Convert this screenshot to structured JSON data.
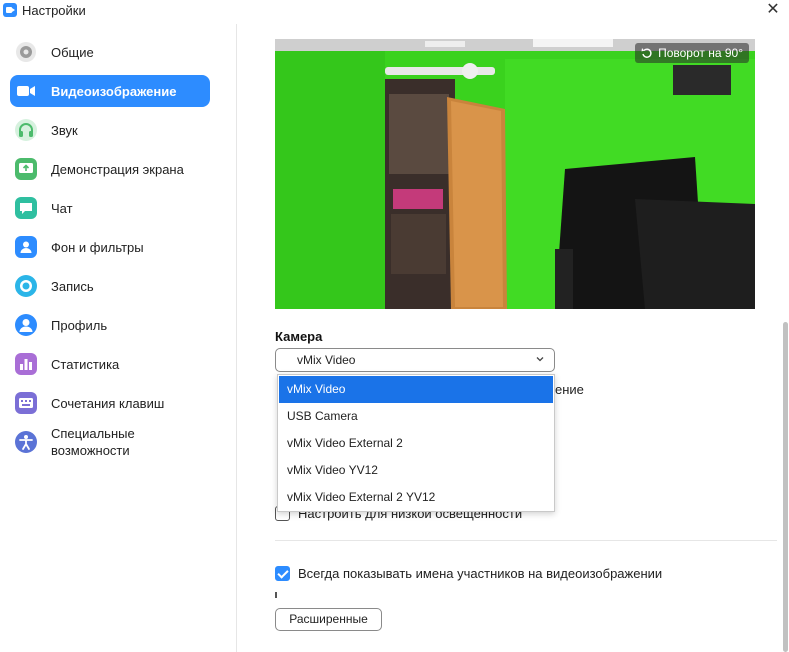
{
  "window": {
    "title": "Настройки"
  },
  "sidebar": {
    "items": [
      {
        "label": "Общие",
        "icon": "gear-icon",
        "color": "#8c8c8c"
      },
      {
        "label": "Видеоизображение",
        "icon": "video-camera-icon",
        "color": "#2D8CFF"
      },
      {
        "label": "Звук",
        "icon": "headphones-icon",
        "color": "#4cbb6c"
      },
      {
        "label": "Демонстрация экрана",
        "icon": "share-screen-icon",
        "color": "#4cbb6c"
      },
      {
        "label": "Чат",
        "icon": "chat-bubble-icon",
        "color": "#2fbfa0"
      },
      {
        "label": "Фон и фильтры",
        "icon": "person-background-icon",
        "color": "#2D8CFF"
      },
      {
        "label": "Запись",
        "icon": "record-icon",
        "color": "#2bb5e8"
      },
      {
        "label": "Профиль",
        "icon": "profile-icon",
        "color": "#2D8CFF"
      },
      {
        "label": "Статистика",
        "icon": "statistics-icon",
        "color": "#a96ed6"
      },
      {
        "label": "Сочетания клавиш",
        "icon": "keyboard-icon",
        "color": "#7b6fd6"
      },
      {
        "label": "Специальные возможности",
        "label_line1": "Специальные",
        "label_line2": "возможности",
        "icon": "accessibility-icon",
        "color": "#5b73d6"
      }
    ],
    "active_index": 1
  },
  "main": {
    "preview": {
      "rotate_label": "Поворот на 90°"
    },
    "camera": {
      "section_label": "Камера",
      "selected": "vMix Video",
      "options": [
        "vMix Video",
        "USB Camera",
        "vMix Video External 2",
        "vMix Video YV12",
        "vMix Video External 2 YV12"
      ]
    },
    "partial_text": "ение",
    "checkbox_low_light": {
      "label": "Настроить для низкой освещенности",
      "checked": false
    },
    "checkbox_show_names": {
      "label": "Всегда показывать имена участников на видеоизображении",
      "checked": true
    },
    "advanced_button": "Расширенные"
  },
  "colors": {
    "accent": "#2D8CFF",
    "dropdown_selected": "#1a73e8"
  }
}
